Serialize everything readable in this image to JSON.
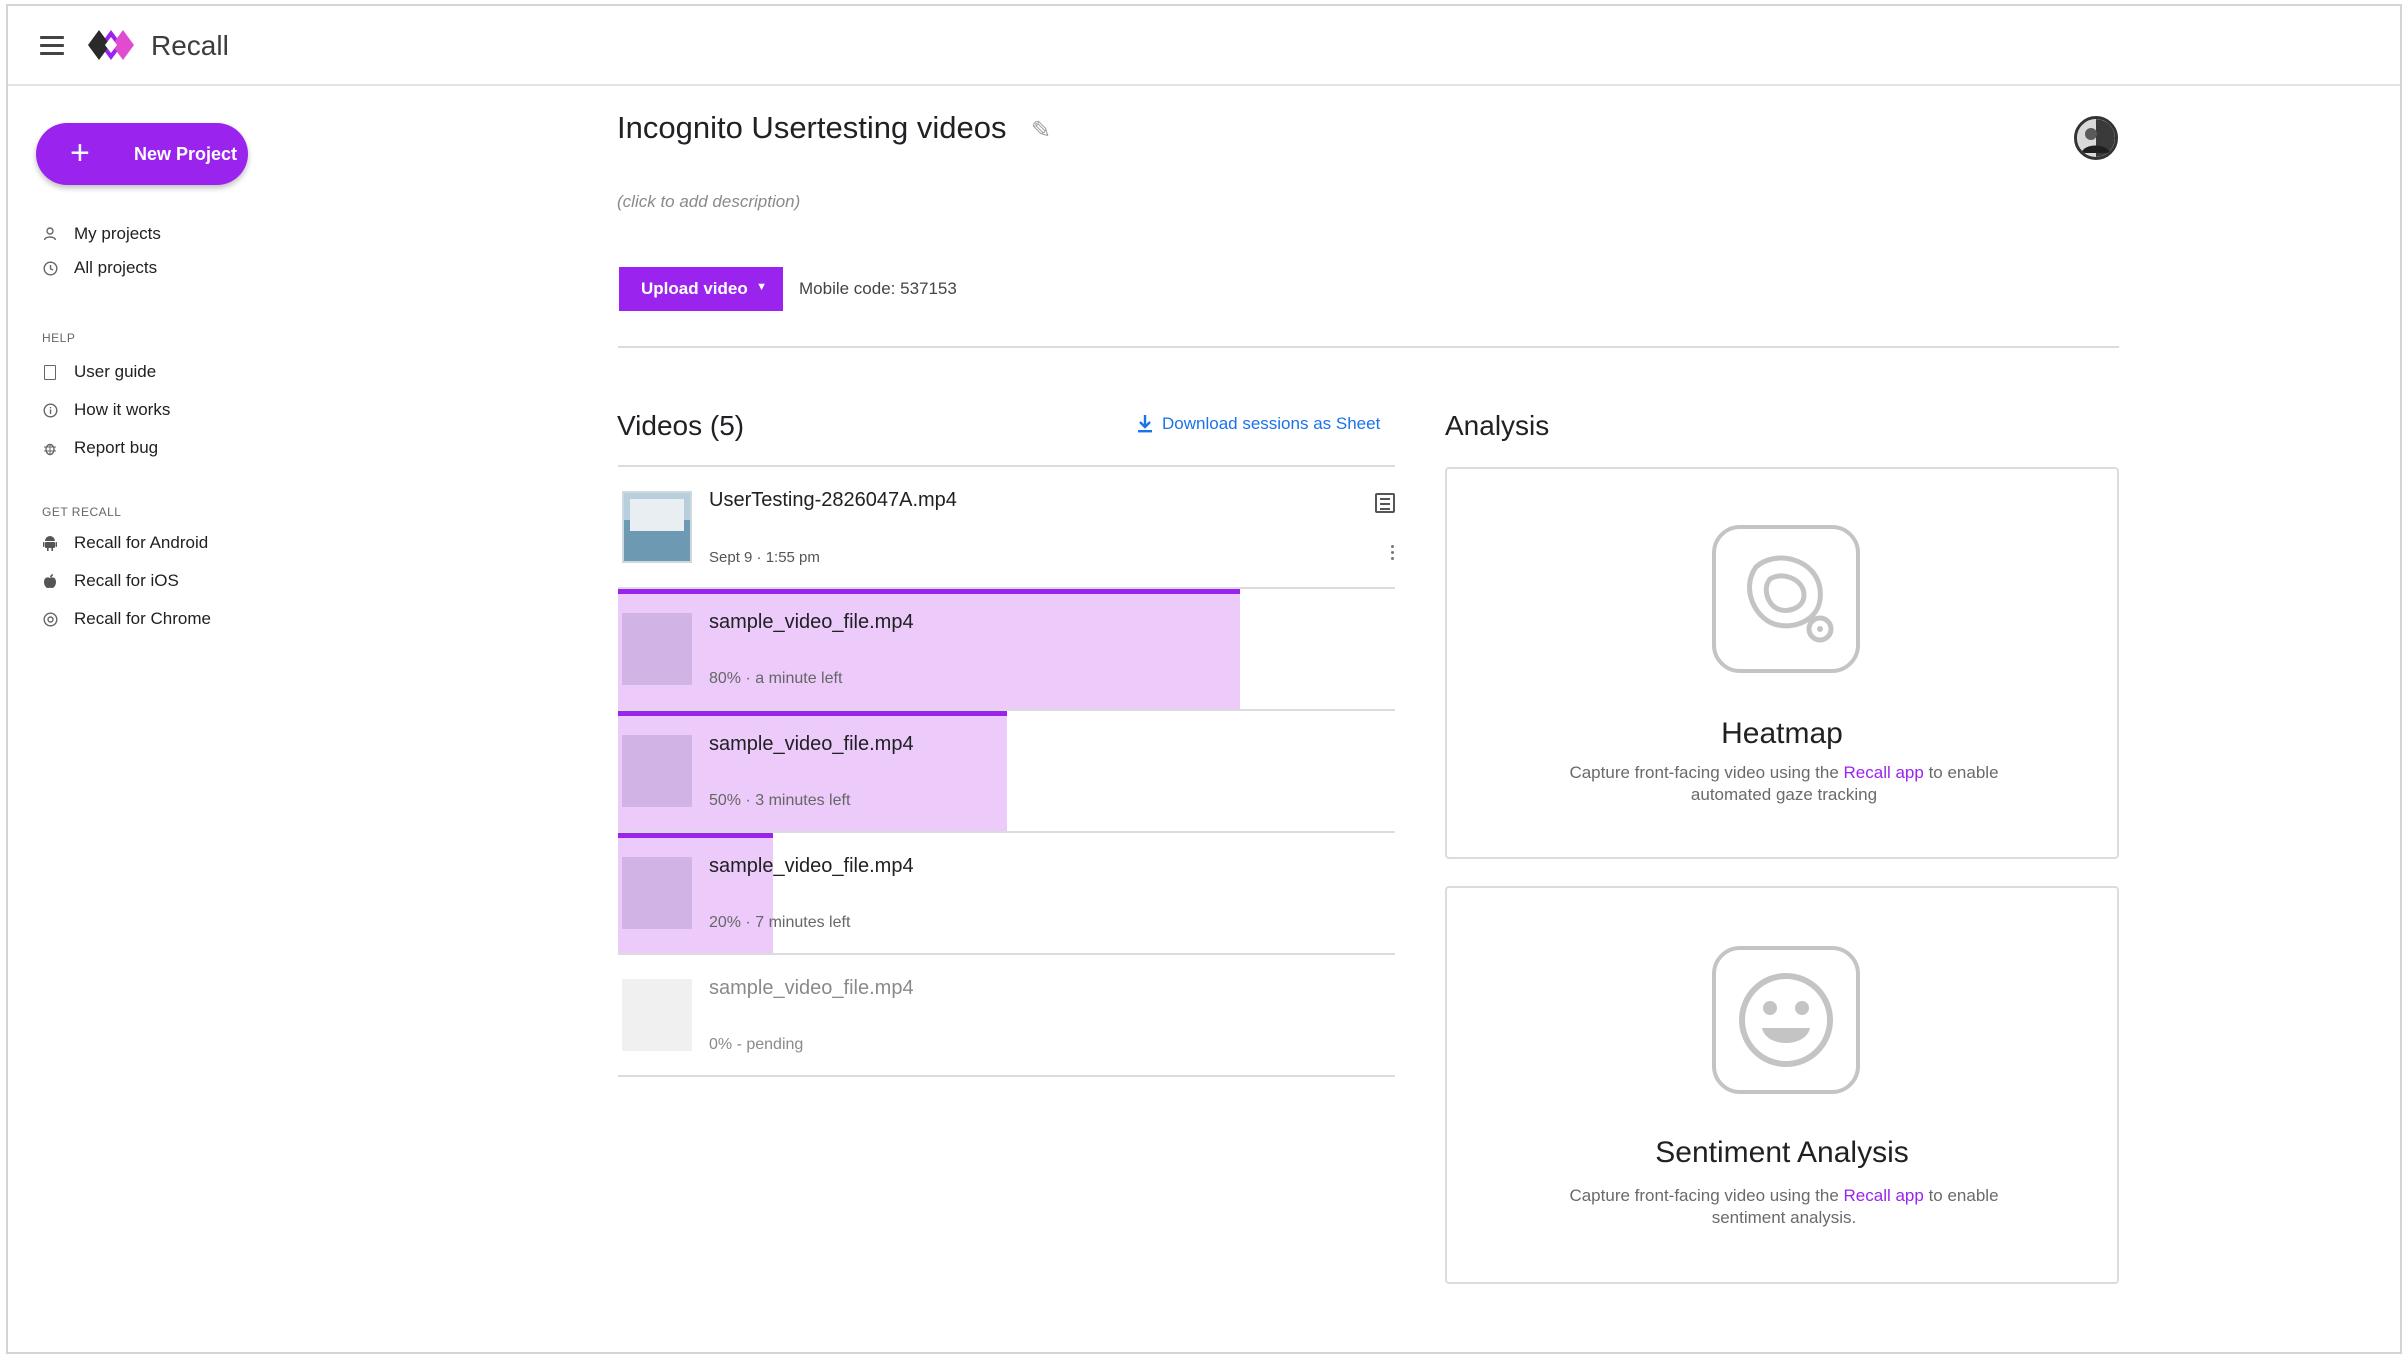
{
  "app": {
    "title": "Recall",
    "accent": "#9a24ee",
    "link_color": "#1a73e8"
  },
  "sidebar": {
    "new_project_label": "New Project",
    "items": [
      {
        "label": "My projects",
        "icon": "person-icon"
      },
      {
        "label": "All projects",
        "icon": "clock-icon"
      }
    ],
    "help_heading": "HELP",
    "help_items": [
      {
        "label": "User guide",
        "icon": "document-icon"
      },
      {
        "label": "How it works",
        "icon": "info-icon"
      },
      {
        "label": "Report bug",
        "icon": "bug-icon"
      }
    ],
    "get_heading": "GET RECALL",
    "get_items": [
      {
        "label": "Recall for Android",
        "icon": "android-icon"
      },
      {
        "label": "Recall for iOS",
        "icon": "apple-icon"
      },
      {
        "label": "Recall for Chrome",
        "icon": "chrome-icon"
      }
    ]
  },
  "project": {
    "title": "Incognito Usertesting videos",
    "description_placeholder": "(click to add description)",
    "upload_label": "Upload video",
    "mobile_code": "Mobile code: 537153"
  },
  "videos": {
    "heading": "Videos (5)",
    "download_label": "Download sessions as Sheet",
    "items": [
      {
        "name": "UserTesting-2826047A.mp4",
        "meta": "Sept 9 · 1:55 pm",
        "status": "done",
        "progress": 1.0
      },
      {
        "name": "sample_video_file.mp4",
        "meta": "80% · a minute left",
        "status": "uploading",
        "progress": 0.8
      },
      {
        "name": "sample_video_file.mp4",
        "meta": "50% · 3 minutes left",
        "status": "uploading",
        "progress": 0.5
      },
      {
        "name": "sample_video_file.mp4",
        "meta": "20% · 7 minutes left",
        "status": "uploading",
        "progress": 0.2
      },
      {
        "name": "sample_video_file.mp4",
        "meta": "0% - pending",
        "status": "pending",
        "progress": 0.0
      }
    ]
  },
  "analysis": {
    "heading": "Analysis",
    "cards": [
      {
        "title": "Heatmap",
        "desc_before": "Capture front-facing video using the ",
        "desc_link": "Recall app",
        "desc_after": " to enable automated gaze tracking",
        "icon": "heatmap-icon"
      },
      {
        "title": "Sentiment Analysis",
        "desc_before": "Capture front-facing video using the ",
        "desc_link": "Recall app",
        "desc_after": " to enable sentiment analysis.",
        "icon": "smiley-icon"
      }
    ]
  }
}
